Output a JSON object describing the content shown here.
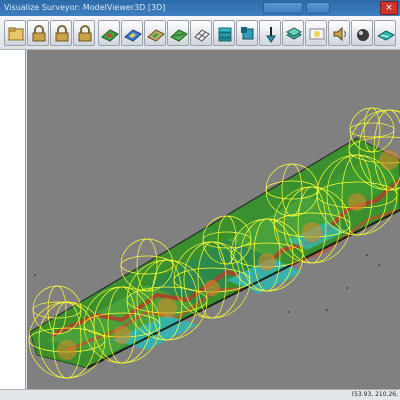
{
  "window": {
    "title": "Visualize Surveyor: ModelViewer3D [3D]",
    "close_glyph": "×"
  },
  "toolbar": {
    "buttons": [
      {
        "id": "open",
        "icon": "open-icon"
      },
      {
        "id": "lock1",
        "icon": "lock-icon"
      },
      {
        "id": "lock2",
        "icon": "lock-icon"
      },
      {
        "id": "lock3",
        "icon": "lock-icon"
      },
      {
        "id": "terrain1",
        "icon": "terrain-icon"
      },
      {
        "id": "terrain2",
        "icon": "terrain-icon"
      },
      {
        "id": "terrain3",
        "icon": "terrain-icon"
      },
      {
        "id": "terrain4",
        "icon": "terrain-icon"
      },
      {
        "id": "grid",
        "icon": "grid-icon"
      },
      {
        "id": "stack",
        "icon": "stack-icon"
      },
      {
        "id": "box",
        "icon": "box-icon"
      },
      {
        "id": "shovel",
        "icon": "shovel-icon"
      },
      {
        "id": "layers",
        "icon": "layers-icon"
      },
      {
        "id": "light",
        "icon": "light-icon"
      },
      {
        "id": "speaker",
        "icon": "speaker-icon"
      },
      {
        "id": "sphere",
        "icon": "sphere-icon"
      },
      {
        "id": "water",
        "icon": "water-icon"
      }
    ]
  },
  "status": {
    "coords": "(53.93, 210.26,"
  },
  "colors": {
    "sphere": "#ffff33",
    "terrain_green": "#2e9e2e",
    "terrain_red": "#b53a2a",
    "water": "#2fb8b8"
  }
}
